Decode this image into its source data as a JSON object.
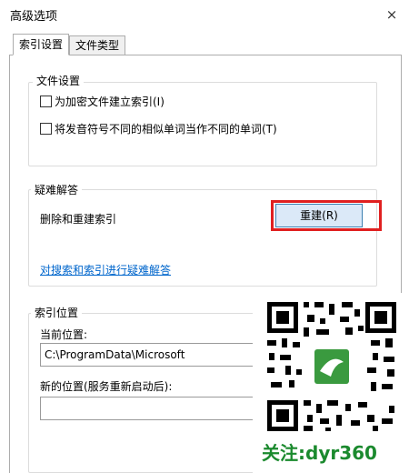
{
  "window": {
    "title": "高级选项",
    "close_glyph": "×"
  },
  "tabs": [
    {
      "label": "索引设置",
      "active": true
    },
    {
      "label": "文件类型",
      "active": false
    }
  ],
  "file_settings": {
    "title": "文件设置",
    "checkboxes": [
      {
        "label": "为加密文件建立索引(I)",
        "checked": false
      },
      {
        "label": "将发音符号不同的相似单词当作不同的单词(T)",
        "checked": false
      }
    ]
  },
  "troubleshooting": {
    "title": "疑难解答",
    "rebuild_label": "删除和重建索引",
    "rebuild_button": "重建(R)",
    "link": "对搜索和索引进行疑难解答"
  },
  "index_location": {
    "title": "索引位置",
    "current_label": "当前位置:",
    "current_value": "C:\\ProgramData\\Microsoft",
    "new_label": "新的位置(服务重新启动后):",
    "new_value": ""
  },
  "watermark": {
    "text": "关注:dyr360",
    "icon": "qr-code-icon"
  },
  "colors": {
    "highlight": "#e02020",
    "link": "#0066cc",
    "button_bg": "#dbe9f8",
    "watermark_text": "#1b8a2e"
  }
}
